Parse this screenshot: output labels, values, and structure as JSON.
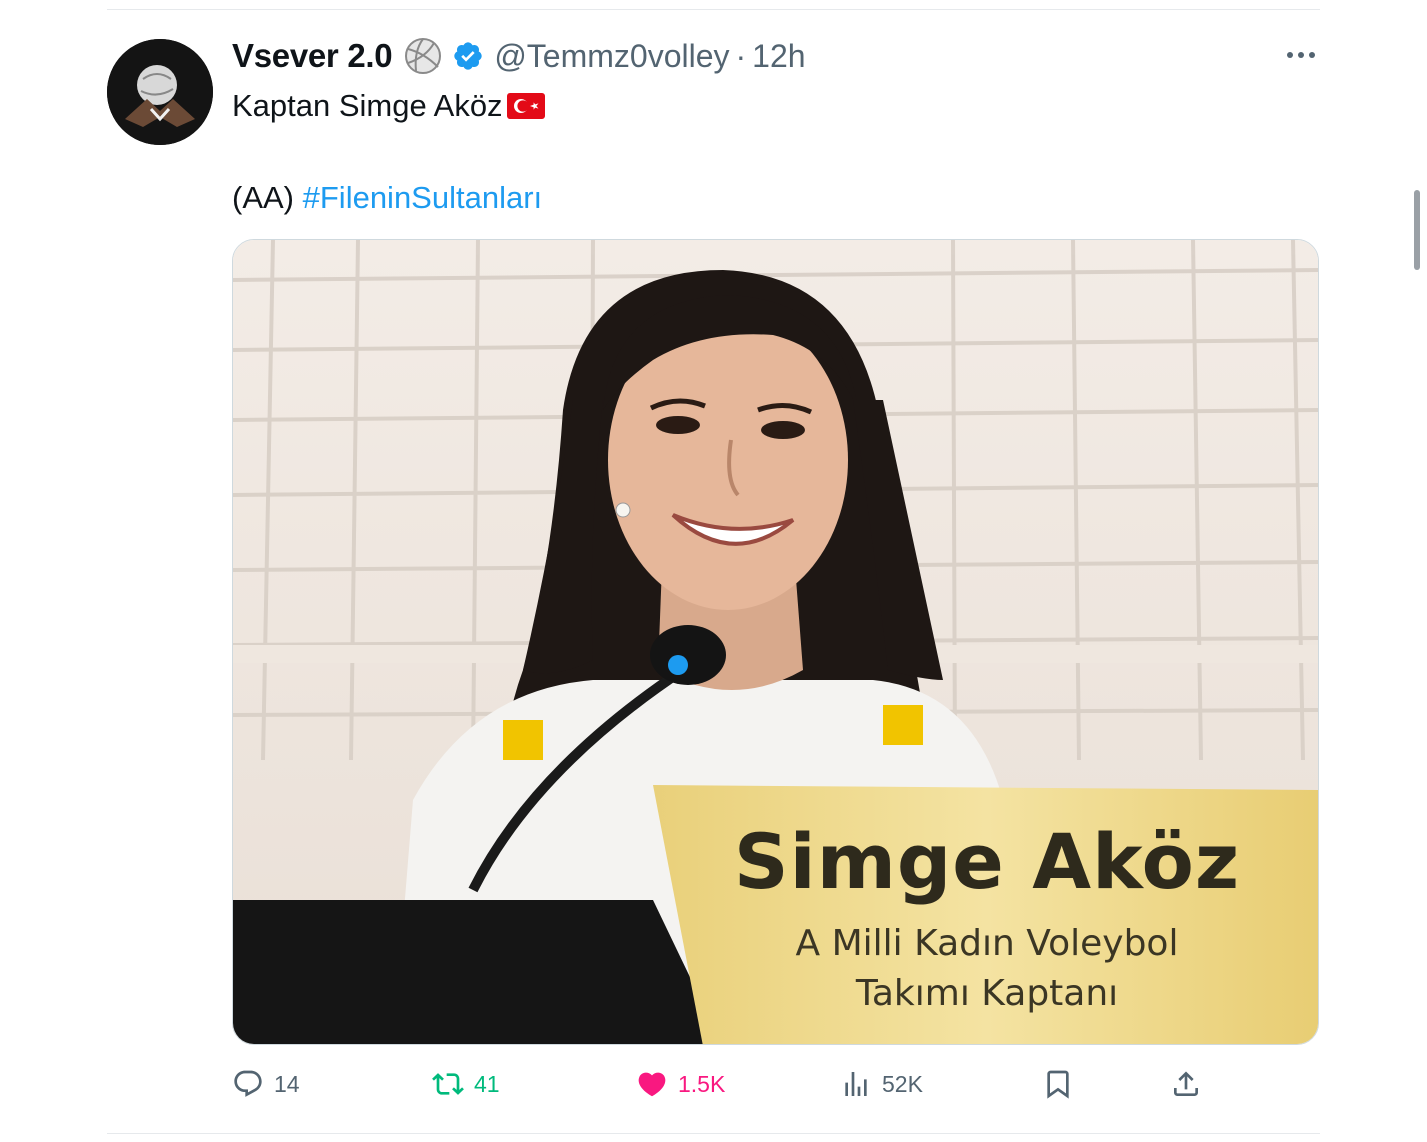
{
  "tweet": {
    "display_name": "Vsever 2.0",
    "handle": "@Temmz0volley",
    "separator": "·",
    "time": "12h",
    "text_line1": "Kaptan Simge Aköz",
    "text_prefix": "(AA)",
    "hashtag": "#FileninSultanları",
    "flag_icon": "turkey-flag-icon",
    "badge_icon": "volleyball-icon",
    "verified_icon": "verified-badge-icon"
  },
  "media": {
    "placard_name": "Simge Aköz",
    "placard_line1": "A Milli Kadın Voleybol",
    "placard_line2": "Takımı Kaptanı"
  },
  "actions": {
    "replies": "14",
    "reposts": "41",
    "likes": "1.5K",
    "views": "52K",
    "liked": true
  },
  "colors": {
    "accent": "#1d9bf0",
    "repost_active": "#00ba7c",
    "like_active": "#f91880",
    "muted": "#536471",
    "placard_gold": "#efd98a"
  }
}
